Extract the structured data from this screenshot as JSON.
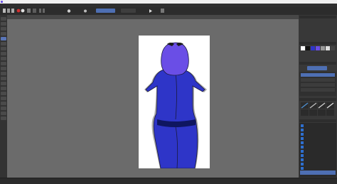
{
  "titlebar": {},
  "menubar": {
    "items": [
      "",
      "",
      "",
      "",
      "",
      "",
      ""
    ]
  },
  "options": {
    "mode": "",
    "zoom": "",
    "brush": ""
  },
  "canvas": {
    "document_title": "",
    "colors": {
      "hair": "#6a4ee6",
      "outfit": "#2e35c8",
      "outline": "#1a1a3c",
      "belt": "#0f1660",
      "bow": "#1c1c1c"
    }
  },
  "dock": {
    "panels": [
      "",
      "",
      "",
      "",
      ""
    ]
  },
  "layers": {
    "items": [
      "",
      "",
      "",
      "",
      "",
      "",
      "",
      "",
      "",
      "",
      "",
      ""
    ]
  },
  "status": {
    "left": "",
    "center": "",
    "right": ""
  },
  "colors": {
    "accent": "#4e6fb3",
    "ui_dark": "#2f2f2f",
    "canvas_bg": "#6b6b6b"
  }
}
